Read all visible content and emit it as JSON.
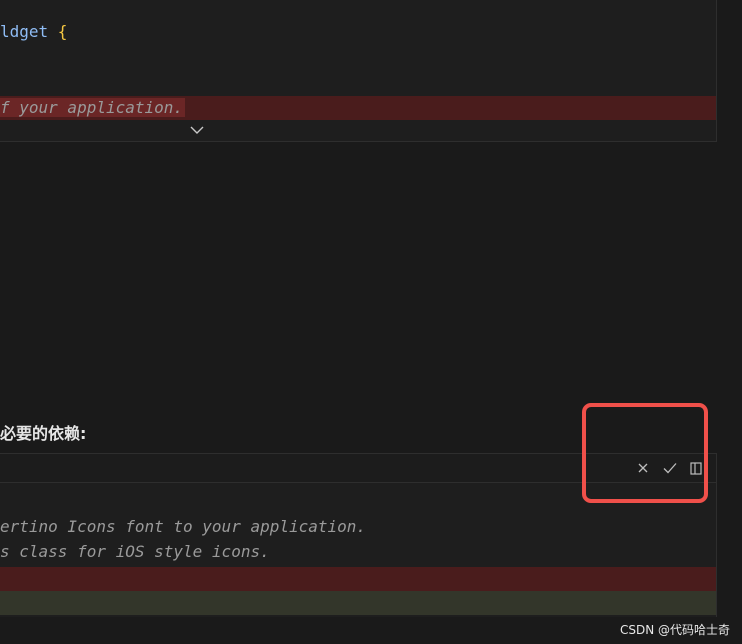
{
  "top_panel": {
    "line_1": {
      "identifier": "ldget",
      "brace": " {"
    },
    "removed_line": {
      "text": "f your application."
    }
  },
  "heading": "必要的依赖:",
  "bottom_panel": {
    "toolbar": {
      "reject_icon": "close-icon",
      "accept_icon": "check-icon",
      "split_icon": "split-view-icon"
    },
    "lines": [
      "ertino Icons font to your application.",
      "s class for iOS style icons."
    ]
  },
  "watermark": "CSDN @代码哈士奇",
  "colors": {
    "background": "#1a1a1a",
    "removed_line_bg": "#4a1c1c",
    "removed_text_bg": "#6b2626",
    "added_line_bg": "#33362a",
    "identifier": "#8fbcf4",
    "brace": "#f5c742",
    "comment": "#9a9a9a",
    "highlight_box": "#f0504a"
  }
}
